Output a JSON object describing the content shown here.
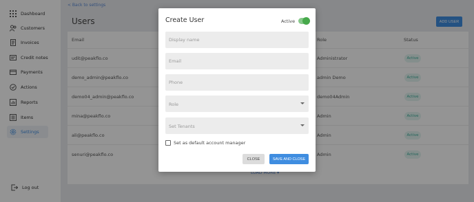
{
  "sidebar": {
    "items": [
      {
        "label": "Dashboard",
        "icon": "grid-icon"
      },
      {
        "label": "Customers",
        "icon": "users-icon"
      },
      {
        "label": "Invoices",
        "icon": "invoice-icon"
      },
      {
        "label": "Credit notes",
        "icon": "credit-note-icon"
      },
      {
        "label": "Payments",
        "icon": "card-icon"
      },
      {
        "label": "Actions",
        "icon": "check-circle-icon"
      },
      {
        "label": "Reports",
        "icon": "report-icon"
      },
      {
        "label": "Items",
        "icon": "items-icon"
      },
      {
        "label": "Settings",
        "icon": "gear-icon",
        "active": true
      }
    ],
    "logout_label": "Log out"
  },
  "page": {
    "back_link": "< Back to settings",
    "title": "Users",
    "add_user_label": "ADD USER",
    "load_more_label": "LOAD MORE"
  },
  "table": {
    "headers": {
      "email": "Email",
      "role": "Role",
      "status": "Status"
    },
    "rows": [
      {
        "email": "udit@peakflo.co",
        "role": "Administrator",
        "status": "Active"
      },
      {
        "email": "demo_admin@peakflo.co",
        "role": "admin Demo",
        "status": "Active"
      },
      {
        "email": "demo04_admin@peakflo.co",
        "role": "demo04Admin",
        "status": "Active"
      },
      {
        "email": "mina@peakflo.co",
        "role": "Admin",
        "status": "Active"
      },
      {
        "email": "ali@peakflo.co",
        "role": "Admin",
        "status": "Active"
      },
      {
        "email": "senuri@peakflo.co",
        "role": "Admin",
        "status": "Active"
      }
    ]
  },
  "modal": {
    "title": "Create User",
    "active_label": "Active",
    "active_on": true,
    "display_name_placeholder": "Display name",
    "email_placeholder": "Email",
    "phone_placeholder": "Phone",
    "role_placeholder": "Role",
    "tenants_placeholder": "Set Tenants",
    "default_manager_label": "Set as default account manager",
    "close_label": "CLOSE",
    "save_label": "SAVE AND CLOSE"
  },
  "colors": {
    "accent": "#3f8de0",
    "toggle_on": "#47a94c",
    "status_badge_bg": "#e3f5f1",
    "status_badge_text": "#3fae9c"
  }
}
